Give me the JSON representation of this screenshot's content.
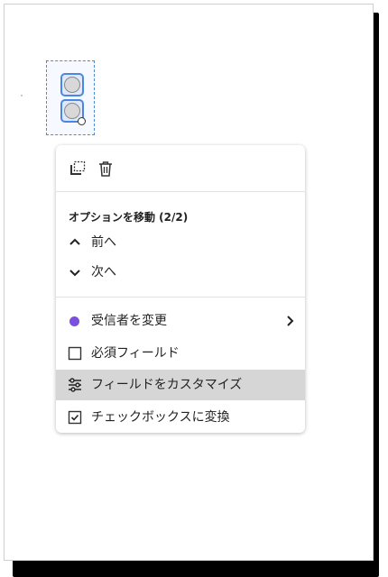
{
  "colors": {
    "selection_blue": "#4b86e2",
    "recipient_dot": "#7b4fe0",
    "highlight_bg": "#d6d6d6"
  },
  "field": {
    "type": "radio-group",
    "items": 2
  },
  "menu": {
    "toolbar": {
      "duplicate_icon": "duplicate-icon",
      "delete_icon": "trash-icon"
    },
    "section_label": "オプションを移動 (2/2)",
    "items": {
      "prev": {
        "label": "前へ",
        "icon": "chevron-up-icon"
      },
      "next": {
        "label": "次へ",
        "icon": "chevron-down-icon"
      },
      "change_recipient": {
        "label": "受信者を変更",
        "icon": "purple-dot-icon"
      },
      "required_field": {
        "label": "必須フィールド",
        "icon": "checkbox-icon"
      },
      "customize_field": {
        "label": "フィールドをカスタマイズ",
        "icon": "sliders-icon"
      },
      "convert_checkbox": {
        "label": "チェックボックスに変換",
        "icon": "checked-box-icon"
      }
    }
  }
}
